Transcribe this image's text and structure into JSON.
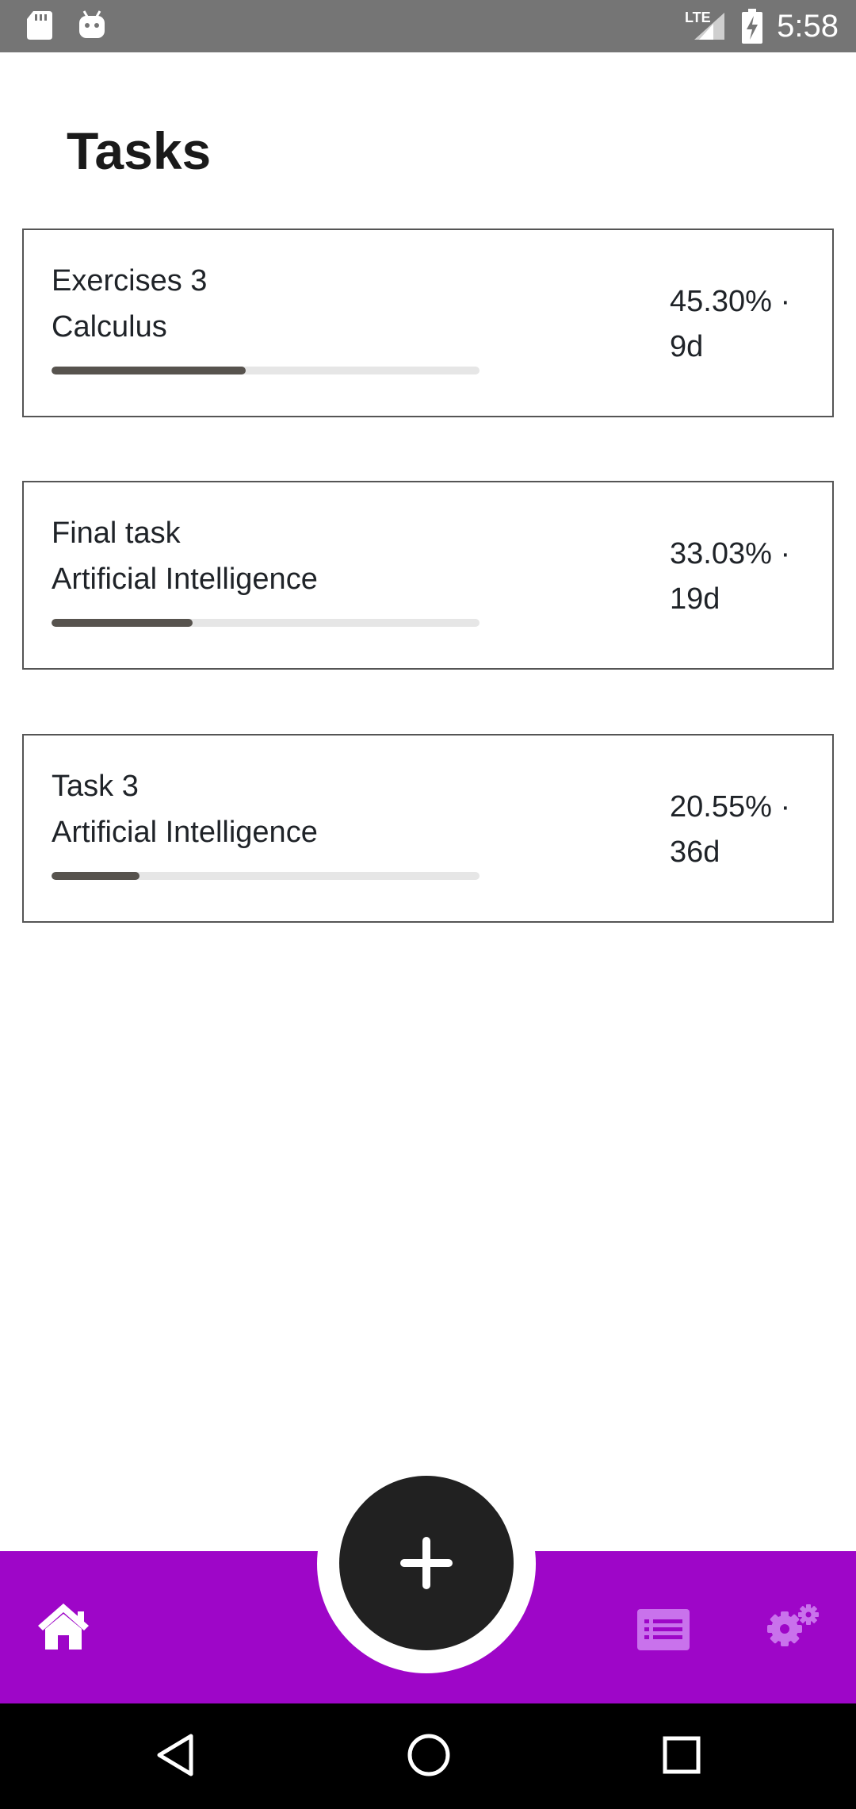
{
  "status_bar": {
    "time": "5:58",
    "network": "LTE",
    "icons": [
      "sd-card-icon",
      "android-debug-icon",
      "lte-signal-icon",
      "battery-charging-icon"
    ]
  },
  "header": {
    "title": "Tasks"
  },
  "tasks": [
    {
      "name": "Exercises 3",
      "subject": "Calculus",
      "percent_label": "45.30% ·",
      "days_label": "9d",
      "progress": 0.453
    },
    {
      "name": "Final task",
      "subject": "Artificial Intelligence",
      "percent_label": "33.03% ·",
      "days_label": "19d",
      "progress": 0.3303
    },
    {
      "name": "Task 3",
      "subject": "Artificial Intelligence",
      "percent_label": "20.55% ·",
      "days_label": "36d",
      "progress": 0.2055
    }
  ],
  "bottom_nav": {
    "items": [
      "home-icon",
      "list-icon",
      "settings-icon"
    ],
    "fab_icon": "plus-icon",
    "colors": {
      "bar": "#9e06c8",
      "active_icon": "#ffffff",
      "inactive_icon": "#c972ec",
      "fab": "#212121"
    }
  },
  "system_nav": {
    "items": [
      "back-icon",
      "home-circle-icon",
      "recents-icon"
    ]
  },
  "colors": {
    "progress_fill": "#57534e",
    "progress_track": "#e6e6e6",
    "card_border": "#555555"
  }
}
